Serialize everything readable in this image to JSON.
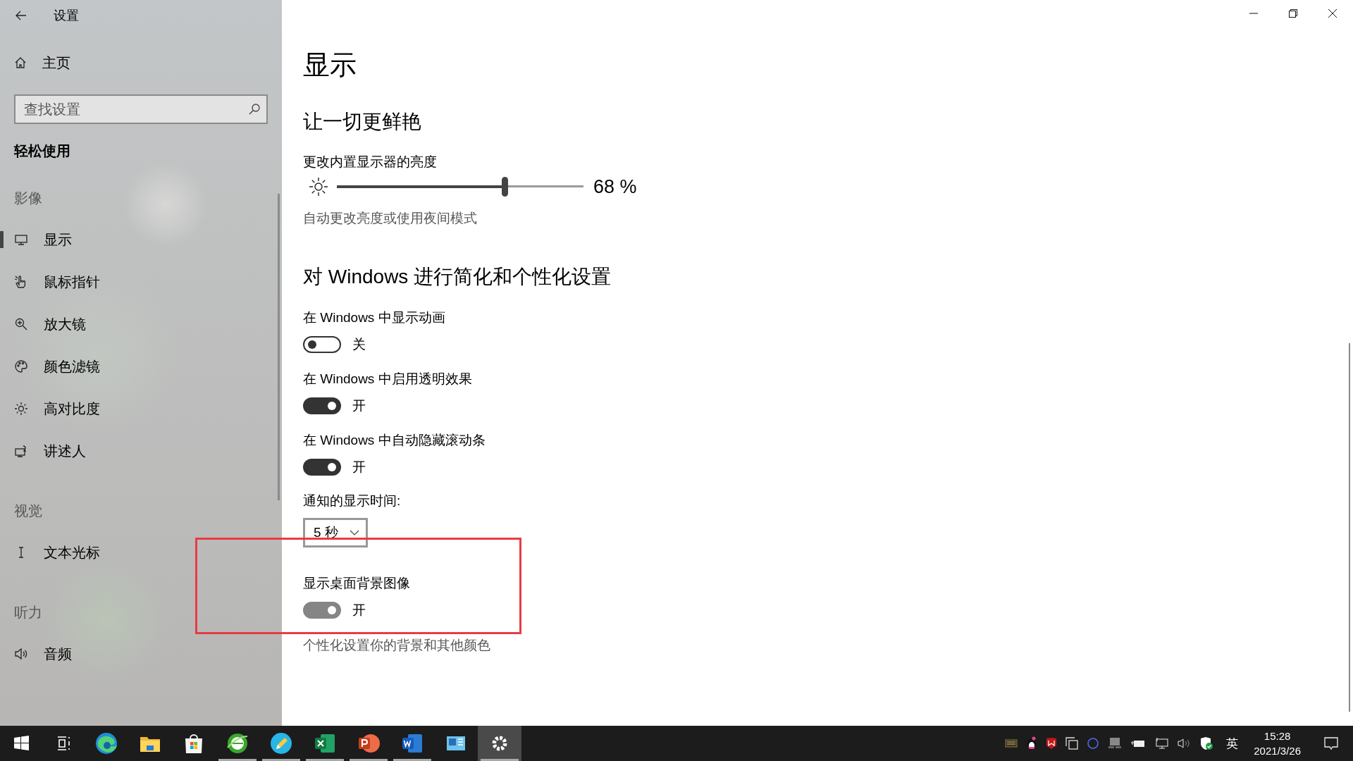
{
  "window": {
    "title": "设置"
  },
  "sidebar": {
    "home": "主页",
    "search": {
      "placeholder": "查找设置"
    },
    "heading": "轻松使用",
    "groups": [
      {
        "title": "影像",
        "items": [
          {
            "label": "显示",
            "selected": true
          },
          {
            "label": "鼠标指针",
            "selected": false
          },
          {
            "label": "放大镜",
            "selected": false
          },
          {
            "label": "颜色滤镜",
            "selected": false
          },
          {
            "label": "高对比度",
            "selected": false
          },
          {
            "label": "讲述人",
            "selected": false
          }
        ]
      },
      {
        "title": "视觉",
        "items": [
          {
            "label": "文本光标",
            "selected": false
          }
        ]
      },
      {
        "title": "听力",
        "items": [
          {
            "label": "音频",
            "selected": false
          }
        ]
      }
    ]
  },
  "main": {
    "title": "显示",
    "sections": [
      {
        "heading": "让一切更鲜艳",
        "items": [
          {
            "kind": "slider",
            "label": "更改内置显示器的亮度",
            "level": 0.68,
            "reading": "68 %"
          },
          {
            "kind": "link",
            "text": "自动更改亮度或使用夜间模式"
          }
        ]
      },
      {
        "heading": "对 Windows 进行简化和个性化设置",
        "items": [
          {
            "kind": "toggle",
            "label": "在 Windows 中显示动画",
            "on": false,
            "disabled": false,
            "state_text": "关"
          },
          {
            "kind": "toggle",
            "label": "在 Windows 中启用透明效果",
            "on": true,
            "disabled": false,
            "state_text": "开"
          },
          {
            "kind": "toggle",
            "label": "在 Windows 中自动隐藏滚动条",
            "on": true,
            "disabled": false,
            "state_text": "开"
          },
          {
            "kind": "dropdown",
            "label": "通知的显示时间:",
            "value": "5 秒"
          },
          {
            "kind": "toggle",
            "label": "显示桌面背景图像",
            "on": true,
            "disabled": true,
            "state_text": "开"
          },
          {
            "kind": "link",
            "text": "个性化设置你的背景和其他颜色"
          }
        ]
      }
    ]
  },
  "taskbar": {
    "apps": [
      {
        "running": false,
        "selected": false
      },
      {
        "running": false,
        "selected": false
      },
      {
        "running": false,
        "selected": false
      },
      {
        "running": true,
        "selected": false
      },
      {
        "running": true,
        "selected": false
      },
      {
        "running": true,
        "selected": false
      },
      {
        "running": true,
        "selected": false
      },
      {
        "running": true,
        "selected": false
      },
      {
        "running": false,
        "selected": false
      },
      {
        "running": true,
        "selected": true
      }
    ],
    "ime": "英",
    "time": "15:28",
    "date": "2021/3/26"
  }
}
